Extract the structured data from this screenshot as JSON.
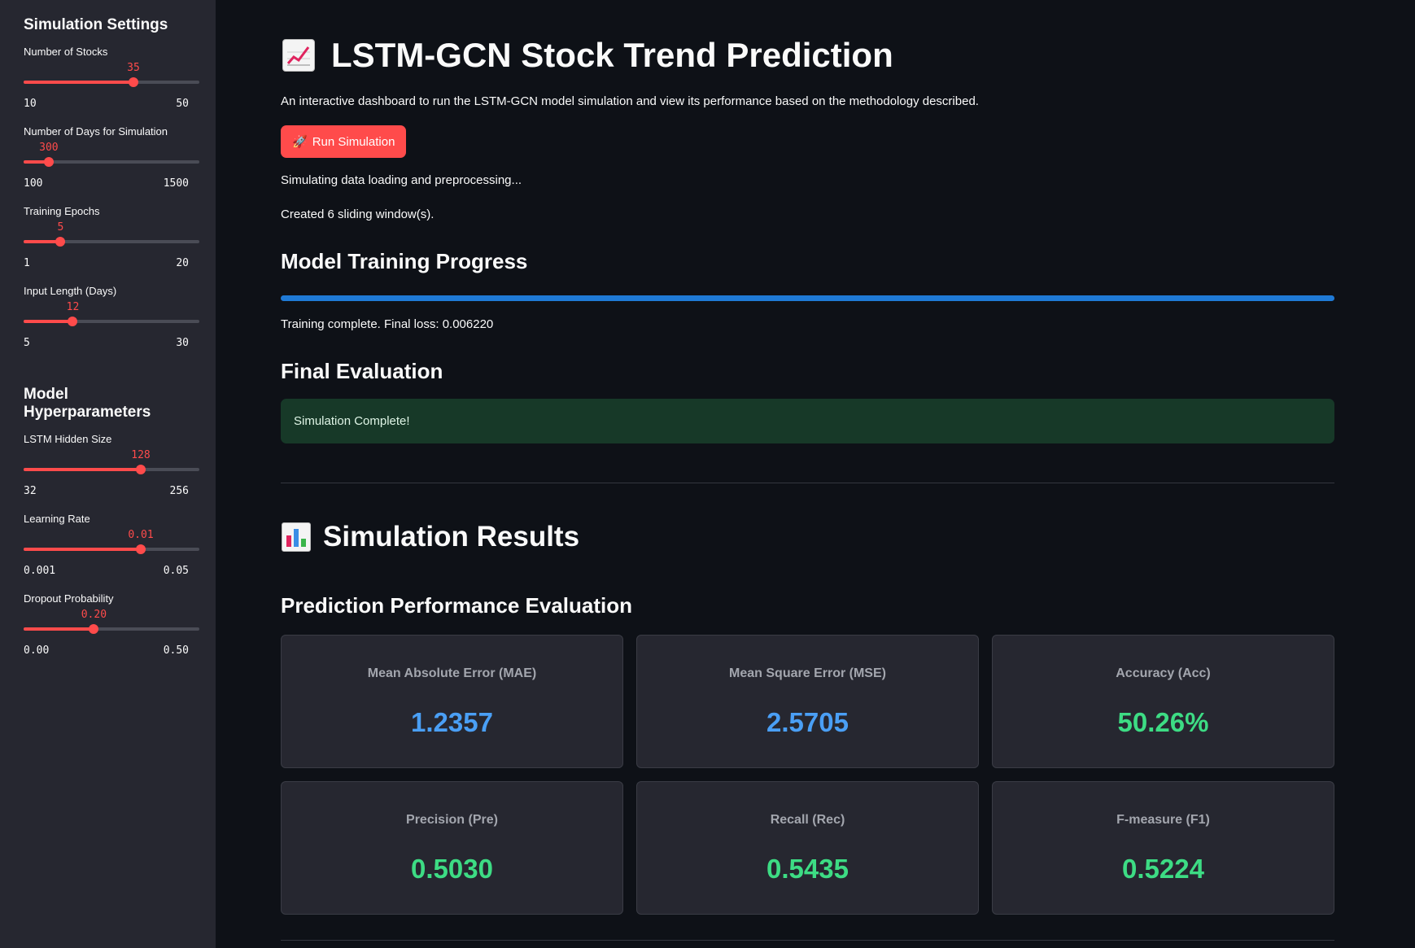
{
  "sidebar": {
    "simulation_heading": "Simulation Settings",
    "hyper_heading": "Model Hyperparameters",
    "sliders": [
      {
        "label": "Number of Stocks",
        "value": "35",
        "min": "10",
        "max": "50",
        "fraction": 0.625
      },
      {
        "label": "Number of Days for Simulation",
        "value": "300",
        "min": "100",
        "max": "1500",
        "fraction": 0.1429
      },
      {
        "label": "Training Epochs",
        "value": "5",
        "min": "1",
        "max": "20",
        "fraction": 0.2105
      },
      {
        "label": "Input Length (Days)",
        "value": "12",
        "min": "5",
        "max": "30",
        "fraction": 0.28
      },
      {
        "label": "LSTM Hidden Size",
        "value": "128",
        "min": "32",
        "max": "256",
        "fraction": 0.6667
      },
      {
        "label": "Learning Rate",
        "value": "0.01",
        "min": "0.001",
        "max": "0.05",
        "fraction": 0.6667
      },
      {
        "label": "Dropout Probability",
        "value": "0.20",
        "min": "0.00",
        "max": "0.50",
        "fraction": 0.4
      }
    ]
  },
  "main": {
    "title": "LSTM-GCN Stock Trend Prediction",
    "title_icon": "chart-increasing-icon",
    "subtitle": "An interactive dashboard to run the LSTM-GCN model simulation and view its performance based on the methodology described.",
    "run_button": "Run Simulation",
    "run_icon": "rocket-icon",
    "status_loading": "Simulating data loading and preprocessing...",
    "status_windows": "Created 6 sliding window(s).",
    "training_heading": "Model Training Progress",
    "progress": 1.0,
    "loss_text": "Training complete. Final loss: 0.006220",
    "final_heading": "Final Evaluation",
    "success_message": "Simulation Complete!",
    "results_title": "Simulation Results",
    "results_icon": "bar-chart-icon",
    "perf_heading": "Prediction Performance Evaluation",
    "metrics": [
      {
        "label": "Mean Absolute Error (MAE)",
        "value": "1.2357",
        "color": "#4a9ff5"
      },
      {
        "label": "Mean Square Error (MSE)",
        "value": "2.5705",
        "color": "#4a9ff5"
      },
      {
        "label": "Accuracy (Acc)",
        "value": "50.26%",
        "color": "#3ddc84"
      },
      {
        "label": "Precision (Pre)",
        "value": "0.5030",
        "color": "#3ddc84"
      },
      {
        "label": "Recall (Rec)",
        "value": "0.5435",
        "color": "#3ddc84"
      },
      {
        "label": "F-measure (F1)",
        "value": "0.5224",
        "color": "#3ddc84"
      }
    ]
  },
  "colors": {
    "accent": "#ff4b4b",
    "progress": "#1f7ad6",
    "success_bg": "#173928"
  }
}
